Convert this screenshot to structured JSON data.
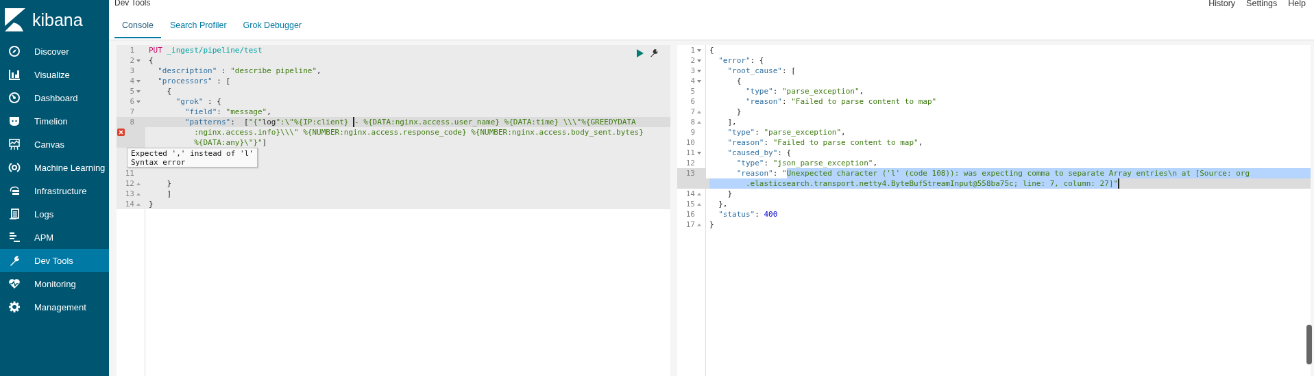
{
  "app": {
    "name": "kibana"
  },
  "sidebar": {
    "items": [
      {
        "label": "Discover",
        "selected": false
      },
      {
        "label": "Visualize",
        "selected": false
      },
      {
        "label": "Dashboard",
        "selected": false
      },
      {
        "label": "Timelion",
        "selected": false
      },
      {
        "label": "Canvas",
        "selected": false
      },
      {
        "label": "Machine Learning",
        "selected": false
      },
      {
        "label": "Infrastructure",
        "selected": false
      },
      {
        "label": "Logs",
        "selected": false
      },
      {
        "label": "APM",
        "selected": false
      },
      {
        "label": "Dev Tools",
        "selected": true
      },
      {
        "label": "Monitoring",
        "selected": false
      },
      {
        "label": "Management",
        "selected": false
      }
    ]
  },
  "header": {
    "title": "Dev Tools",
    "links": [
      "History",
      "Settings",
      "Help"
    ]
  },
  "tabs": [
    {
      "label": "Console",
      "selected": true
    },
    {
      "label": "Search Profiler",
      "selected": false
    },
    {
      "label": "Grok Debugger",
      "selected": false
    }
  ],
  "request_editor": {
    "lines": [
      {
        "number": "1",
        "kind": "plain",
        "active": false,
        "error": false,
        "rows": [
          {
            "kind": "plain",
            "tokens": [
              {
                "kind": "method",
                "text": "PUT"
              },
              {
                "kind": "url",
                "text": " _ingest/pipeline/test"
              }
            ]
          }
        ]
      },
      {
        "number": "2",
        "kind": "fold-start",
        "active": false,
        "error": false,
        "rows": [
          {
            "kind": "plain",
            "tokens": [
              {
                "kind": "punct",
                "text": "{"
              }
            ]
          }
        ]
      },
      {
        "number": "3",
        "kind": "plain",
        "active": false,
        "error": false,
        "rows": [
          {
            "kind": "plain",
            "tokens": [
              {
                "kind": "key",
                "text": "  \"description\""
              },
              {
                "kind": "punct",
                "text": " : "
              },
              {
                "kind": "string",
                "text": "\"describe pipeline\""
              },
              {
                "kind": "punct",
                "text": ","
              }
            ]
          }
        ]
      },
      {
        "number": "4",
        "kind": "fold-start",
        "active": false,
        "error": false,
        "rows": [
          {
            "kind": "plain",
            "tokens": [
              {
                "kind": "key",
                "text": "  \"processors\""
              },
              {
                "kind": "punct",
                "text": " : ["
              }
            ]
          }
        ]
      },
      {
        "number": "5",
        "kind": "fold-start",
        "active": false,
        "error": false,
        "rows": [
          {
            "kind": "plain",
            "tokens": [
              {
                "kind": "punct",
                "text": "    {"
              }
            ]
          }
        ]
      },
      {
        "number": "6",
        "kind": "fold-start",
        "active": false,
        "error": false,
        "rows": [
          {
            "kind": "plain",
            "tokens": [
              {
                "kind": "key",
                "text": "      \"grok\""
              },
              {
                "kind": "punct",
                "text": " : {"
              }
            ]
          }
        ]
      },
      {
        "number": "7",
        "kind": "plain",
        "active": false,
        "error": false,
        "rows": [
          {
            "kind": "plain",
            "tokens": [
              {
                "kind": "key",
                "text": "        \"field\""
              },
              {
                "kind": "punct",
                "text": ": "
              },
              {
                "kind": "string",
                "text": "\"message\""
              },
              {
                "kind": "punct",
                "text": ","
              }
            ]
          }
        ]
      },
      {
        "number": "8",
        "kind": "plain",
        "active": true,
        "error": true,
        "rows": [
          {
            "kind": "active",
            "tokens": [
              {
                "kind": "key",
                "text": "        \"patterns\""
              },
              {
                "kind": "punct",
                "text": ":  ["
              },
              {
                "kind": "string",
                "text": "\"{\""
              },
              {
                "kind": "punct",
                "text": "log"
              },
              {
                "kind": "string",
                "text": "\":\\\"%{IP:client} "
              },
              {
                "kind": "cursor"
              },
              {
                "kind": "string",
                "text": "- %{DATA:nginx.access.user_name} %{DATA:time} \\\\\\\"%{GREEDYDATA"
              }
            ]
          },
          {
            "kind": "plain",
            "tokens": [
              {
                "kind": "string",
                "text": "          :nginx.access.info}\\\\\\\" %{NUMBER:nginx.access.response_code} %{NUMBER:nginx.access.body_sent.bytes}"
              }
            ]
          },
          {
            "kind": "plain",
            "tokens": [
              {
                "kind": "string",
                "text": "          %{DATA:any}\\\"}\""
              },
              {
                "kind": "punct",
                "text": "]"
              }
            ]
          }
        ]
      },
      {
        "kind": "plain",
        "active": false,
        "error": false,
        "rows": [
          {
            "kind": "plain"
          }
        ]
      },
      {
        "kind": "plain",
        "active": false,
        "error": false,
        "rows": [
          {
            "kind": "plain"
          }
        ]
      },
      {
        "number": "11",
        "kind": "plain",
        "active": false,
        "error": false,
        "rows": [
          {
            "kind": "plain"
          }
        ]
      },
      {
        "number": "12",
        "kind": "fold-end",
        "active": false,
        "error": false,
        "rows": [
          {
            "kind": "plain",
            "tokens": [
              {
                "kind": "punct",
                "text": "    }"
              }
            ]
          }
        ]
      },
      {
        "number": "13",
        "kind": "fold-end",
        "active": false,
        "error": false,
        "rows": [
          {
            "kind": "plain",
            "tokens": [
              {
                "kind": "punct",
                "text": "    ]"
              }
            ]
          }
        ]
      },
      {
        "number": "14",
        "kind": "fold-end",
        "active": false,
        "error": false,
        "rows": [
          {
            "kind": "plain",
            "tokens": [
              {
                "kind": "punct",
                "text": "}"
              }
            ]
          }
        ]
      }
    ],
    "tooltip": [
      "Expected ',' instead of 'l'",
      "Syntax error"
    ]
  },
  "response_editor": {
    "lines": [
      {
        "number": "1",
        "kind": "fold-start",
        "active": false,
        "error": false,
        "rows": [
          {
            "kind": "plain",
            "tokens": [
              {
                "kind": "punct",
                "text": "{"
              }
            ]
          }
        ]
      },
      {
        "number": "2",
        "kind": "fold-start",
        "active": false,
        "error": false,
        "rows": [
          {
            "kind": "plain",
            "tokens": [
              {
                "kind": "key",
                "text": "  \"error\""
              },
              {
                "kind": "punct",
                "text": ": {"
              }
            ]
          }
        ]
      },
      {
        "number": "3",
        "kind": "fold-start",
        "active": false,
        "error": false,
        "rows": [
          {
            "kind": "plain",
            "tokens": [
              {
                "kind": "key",
                "text": "    \"root_cause\""
              },
              {
                "kind": "punct",
                "text": ": ["
              }
            ]
          }
        ]
      },
      {
        "number": "4",
        "kind": "fold-start",
        "active": false,
        "error": false,
        "rows": [
          {
            "kind": "plain",
            "tokens": [
              {
                "kind": "punct",
                "text": "      {"
              }
            ]
          }
        ]
      },
      {
        "number": "5",
        "kind": "plain",
        "active": false,
        "error": false,
        "rows": [
          {
            "kind": "plain",
            "tokens": [
              {
                "kind": "key",
                "text": "        \"type\""
              },
              {
                "kind": "punct",
                "text": ": "
              },
              {
                "kind": "string",
                "text": "\"parse_exception\""
              },
              {
                "kind": "punct",
                "text": ","
              }
            ]
          }
        ]
      },
      {
        "number": "6",
        "kind": "plain",
        "active": false,
        "error": false,
        "rows": [
          {
            "kind": "plain",
            "tokens": [
              {
                "kind": "key",
                "text": "        \"reason\""
              },
              {
                "kind": "punct",
                "text": ": "
              },
              {
                "kind": "string",
                "text": "\"Failed to parse content to map\""
              }
            ]
          }
        ]
      },
      {
        "number": "7",
        "kind": "fold-end",
        "active": false,
        "error": false,
        "rows": [
          {
            "kind": "plain",
            "tokens": [
              {
                "kind": "punct",
                "text": "      }"
              }
            ]
          }
        ]
      },
      {
        "number": "8",
        "kind": "fold-end",
        "active": false,
        "error": false,
        "rows": [
          {
            "kind": "plain",
            "tokens": [
              {
                "kind": "punct",
                "text": "    ],"
              }
            ]
          }
        ]
      },
      {
        "number": "9",
        "kind": "plain",
        "active": false,
        "error": false,
        "rows": [
          {
            "kind": "plain",
            "tokens": [
              {
                "kind": "key",
                "text": "    \"type\""
              },
              {
                "kind": "punct",
                "text": ": "
              },
              {
                "kind": "string",
                "text": "\"parse_exception\""
              },
              {
                "kind": "punct",
                "text": ","
              }
            ]
          }
        ]
      },
      {
        "number": "10",
        "kind": "plain",
        "active": false,
        "error": false,
        "rows": [
          {
            "kind": "plain",
            "tokens": [
              {
                "kind": "key",
                "text": "    \"reason\""
              },
              {
                "kind": "punct",
                "text": ": "
              },
              {
                "kind": "string",
                "text": "\"Failed to parse content to map\""
              },
              {
                "kind": "punct",
                "text": ","
              }
            ]
          }
        ]
      },
      {
        "number": "11",
        "kind": "fold-start",
        "active": false,
        "error": false,
        "rows": [
          {
            "kind": "plain",
            "tokens": [
              {
                "kind": "key",
                "text": "    \"caused_by\""
              },
              {
                "kind": "punct",
                "text": ": {"
              }
            ]
          }
        ]
      },
      {
        "number": "12",
        "kind": "plain",
        "active": false,
        "error": false,
        "rows": [
          {
            "kind": "plain",
            "tokens": [
              {
                "kind": "key",
                "text": "      \"type\""
              },
              {
                "kind": "punct",
                "text": ": "
              },
              {
                "kind": "string",
                "text": "\"json_parse_exception\""
              },
              {
                "kind": "punct",
                "text": ","
              }
            ]
          }
        ]
      },
      {
        "number": "13",
        "kind": "plain",
        "active": true,
        "error": false,
        "rows": [
          {
            "kind": "selection",
            "tokens": [
              {
                "kind": "key",
                "text": "      \"reason\""
              },
              {
                "kind": "punct",
                "text": ": "
              },
              {
                "kind": "string",
                "text": "\""
              },
              {
                "kind": "selection",
                "text": "Unexpected character ('l' (code 108)): was expecting comma to separate Array entries\\n at [Source: org"
              }
            ]
          },
          {
            "kind": "active",
            "tokens": [
              {
                "kind": "selection",
                "text": "        .elasticsearch.transport.netty4.ByteBufStreamInput@558ba75c; line: 7, column: 27]\""
              },
              {
                "kind": "cursor"
              }
            ]
          }
        ]
      },
      {
        "number": "14",
        "kind": "fold-end",
        "active": false,
        "error": false,
        "rows": [
          {
            "kind": "plain",
            "tokens": [
              {
                "kind": "punct",
                "text": "    }"
              }
            ]
          }
        ]
      },
      {
        "number": "15",
        "kind": "fold-end",
        "active": false,
        "error": false,
        "rows": [
          {
            "kind": "plain",
            "tokens": [
              {
                "kind": "punct",
                "text": "  },"
              }
            ]
          }
        ]
      },
      {
        "number": "16",
        "kind": "plain",
        "active": false,
        "error": false,
        "rows": [
          {
            "kind": "plain",
            "tokens": [
              {
                "kind": "key",
                "text": "  \"status\""
              },
              {
                "kind": "punct",
                "text": ": "
              },
              {
                "kind": "number",
                "text": "400"
              }
            ]
          }
        ]
      },
      {
        "number": "17",
        "kind": "fold-end",
        "active": false,
        "error": false,
        "rows": [
          {
            "kind": "plain",
            "tokens": [
              {
                "kind": "punct",
                "text": "}"
              }
            ]
          }
        ]
      }
    ]
  }
}
